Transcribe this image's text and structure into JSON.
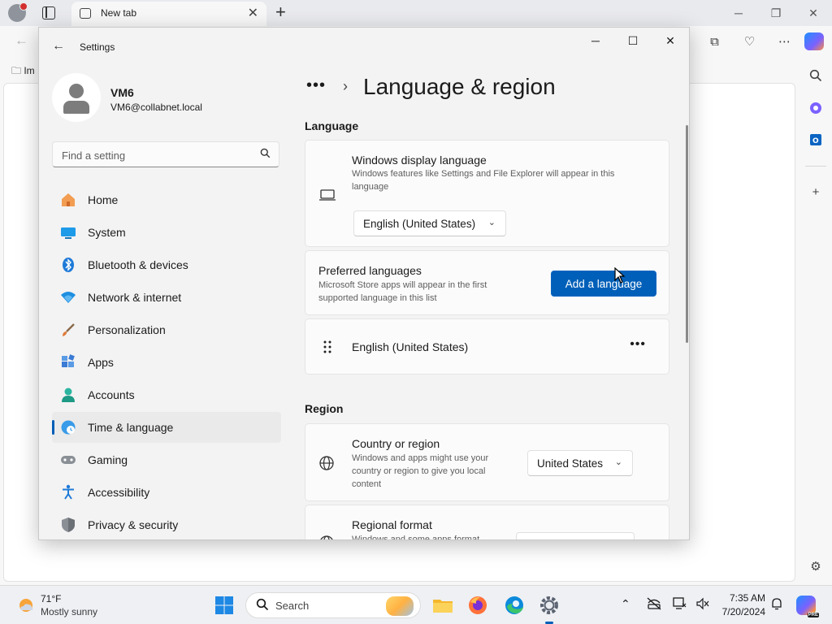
{
  "browser": {
    "tab_title": "New tab",
    "fav_item": "Im",
    "colors": {
      "chrome": "#e9eaee",
      "toolbar": "#f7f7f7"
    }
  },
  "settings": {
    "window_title": "Settings",
    "user": {
      "name": "VM6",
      "email": "VM6@collabnet.local"
    },
    "search_placeholder": "Find a setting",
    "nav": [
      {
        "label": "Home",
        "icon": "home-icon"
      },
      {
        "label": "System",
        "icon": "system-icon"
      },
      {
        "label": "Bluetooth & devices",
        "icon": "bluetooth-icon"
      },
      {
        "label": "Network & internet",
        "icon": "wifi-icon"
      },
      {
        "label": "Personalization",
        "icon": "brush-icon"
      },
      {
        "label": "Apps",
        "icon": "apps-icon"
      },
      {
        "label": "Accounts",
        "icon": "accounts-icon"
      },
      {
        "label": "Time & language",
        "icon": "globe-clock-icon",
        "selected": true
      },
      {
        "label": "Gaming",
        "icon": "gamepad-icon"
      },
      {
        "label": "Accessibility",
        "icon": "accessibility-icon"
      },
      {
        "label": "Privacy & security",
        "icon": "shield-icon"
      }
    ],
    "breadcrumb_overflow": "•••",
    "page_title": "Language & region",
    "language_section": {
      "heading": "Language",
      "display_language": {
        "title": "Windows display language",
        "description": "Windows features like Settings and File Explorer will appear in this language",
        "value": "English (United States)"
      },
      "preferred": {
        "title": "Preferred languages",
        "description": "Microsoft Store apps will appear in the first supported language in this list",
        "button": "Add a language"
      },
      "languages": [
        {
          "name": "English (United States)"
        }
      ]
    },
    "region_section": {
      "heading": "Region",
      "country": {
        "title": "Country or region",
        "description": "Windows and apps might use your country or region to give you local content",
        "value": "United States"
      },
      "format": {
        "title": "Regional format",
        "description": "Windows and some apps format"
      }
    },
    "accent_color": "#005fb8"
  },
  "taskbar": {
    "weather_temp": "71°F",
    "weather_desc": "Mostly sunny",
    "search_label": "Search",
    "time": "7:35 AM",
    "date": "7/20/2024"
  }
}
